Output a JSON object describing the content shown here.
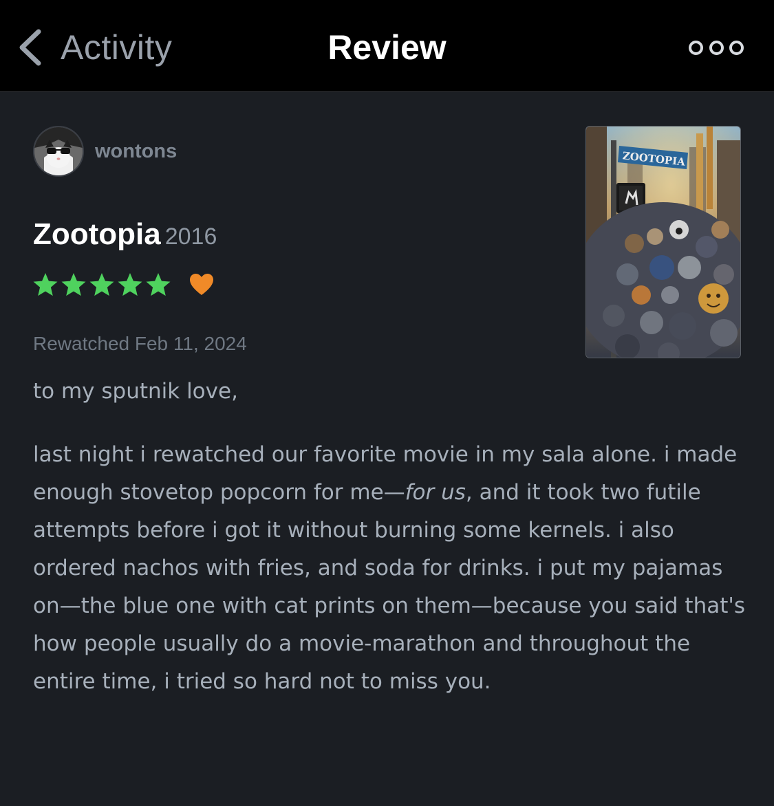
{
  "nav": {
    "back_label": "Activity",
    "title": "Review"
  },
  "review": {
    "username": "wontons",
    "film_title": "Zootopia",
    "film_year": "2016",
    "rating_stars": 5,
    "liked": true,
    "watch_label": "Rewatched Feb 11, 2024",
    "paragraph_1": "to my sputnik love,",
    "paragraph_2_part_1": "last night i rewatched our favorite movie in my sala alone. i made enough stovetop popcorn for me—",
    "paragraph_2_italic": "for us",
    "paragraph_2_part_2": ", and it took two futile attempts before i got it without burning some kernels. i also ordered nachos with fries, and soda for drinks. i put my pajamas on—the blue one with cat prints on them—because you said that's how people usually do a movie-marathon and throughout the entire time, i tried so hard not to miss you."
  },
  "poster": {
    "logo_text": "ZOOTOPIA"
  },
  "colors": {
    "background": "#1b1e23",
    "navbar": "#000000",
    "star_green": "#4fd25e",
    "heart_orange": "#f08a28",
    "username": "#7e8792",
    "body_text": "#a7b0bb"
  },
  "icons": {
    "back": "chevron-left-icon",
    "more": "more-horizontal-icon",
    "star": "star-icon",
    "heart": "heart-icon"
  }
}
